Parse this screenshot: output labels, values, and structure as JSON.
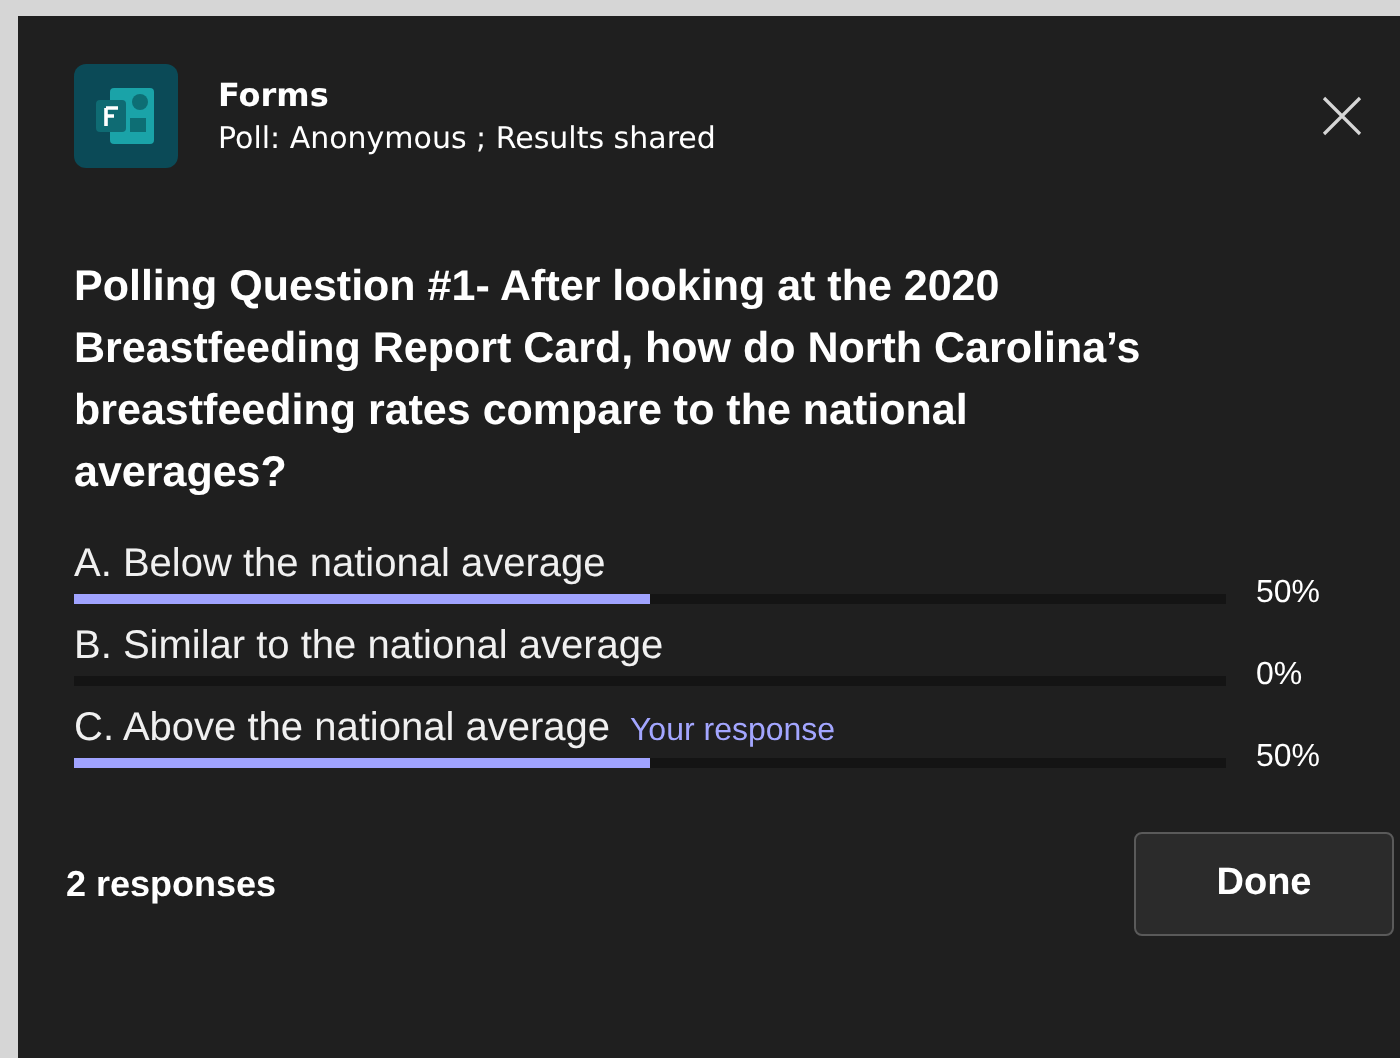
{
  "app": {
    "name": "Forms",
    "subtitle": "Poll: Anonymous ; Results shared"
  },
  "question": "Polling Question #1-  After looking at the 2020 Breastfeeding Report Card, how do North Carolina’s breastfeeding rates compare to the national averages?",
  "response_tag": "Your response",
  "options": [
    {
      "label": "A. Below the national average",
      "level": 0.5,
      "percent": "50%",
      "selected": false
    },
    {
      "label": "B. Similar to the national average",
      "level": 0,
      "percent": "0%",
      "selected": false
    },
    {
      "label": "C. Above the national average",
      "level": 0.5,
      "percent": "50%",
      "selected": true
    }
  ],
  "footer": {
    "count": "2 responses",
    "button": "Done"
  }
}
